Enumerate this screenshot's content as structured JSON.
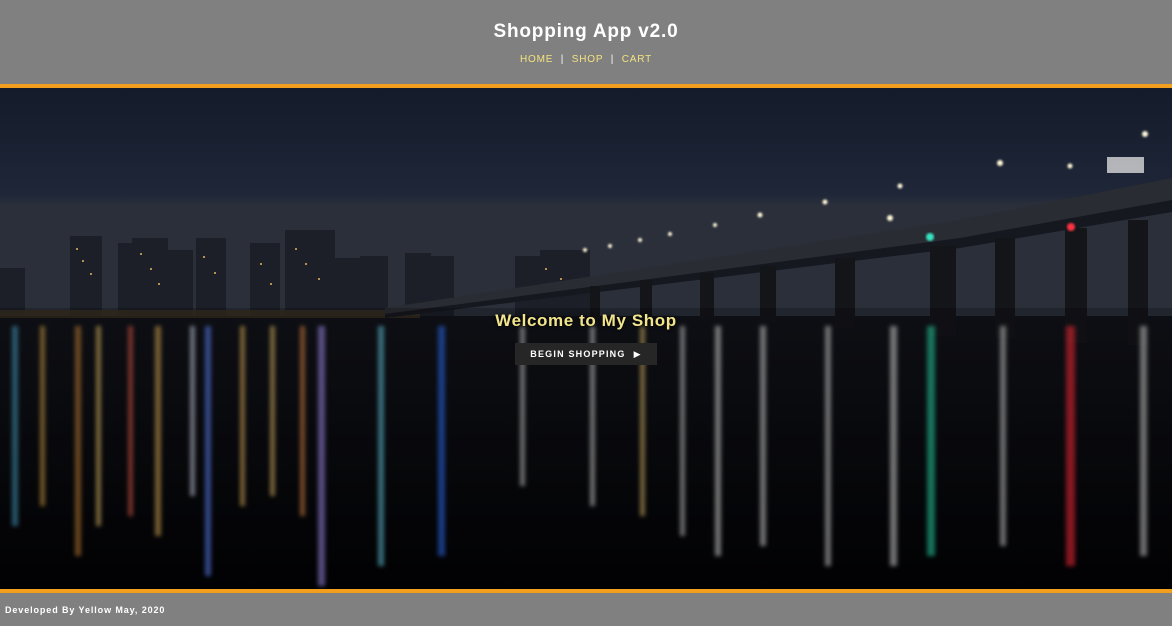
{
  "header": {
    "title": "Shopping App v2.0",
    "nav": {
      "home": "HOME",
      "shop": "SHOP",
      "cart": "CART",
      "separator": "|"
    }
  },
  "hero": {
    "heading": "Welcome to My Shop",
    "button_label": "BEGIN SHOPPING",
    "button_icon": "play-icon"
  },
  "footer": {
    "text": "Developed By Yellow May, 2020"
  },
  "colors": {
    "header_bg": "#808080",
    "accent": "#f29e1f",
    "nav_link": "#f3e37f",
    "hero_heading": "#f2e58b",
    "button_bg": "#262626"
  }
}
